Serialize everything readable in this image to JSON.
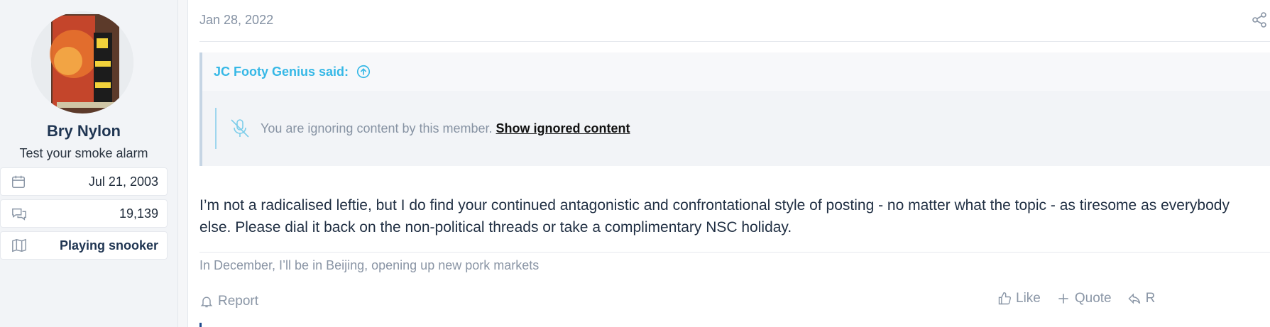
{
  "user": {
    "name": "Bry Nylon",
    "title": "Test your smoke alarm",
    "stats": [
      {
        "icon": "calendar-icon",
        "value": "Jul 21, 2003"
      },
      {
        "icon": "messages-icon",
        "value": "19,139"
      },
      {
        "icon": "map-icon",
        "value": "Playing snooker"
      }
    ]
  },
  "post": {
    "date": "Jan 28, 2022",
    "quote": {
      "author_line": "JC Footy Genius said:",
      "ignored_text": "You are ignoring content by this member.",
      "show_link": "Show ignored content"
    },
    "message": "I’m not a radicalised leftie, but I do find your continued antagonistic and confrontational style of posting - no matter what the topic - as tiresome as everybody else. Please dial it back on the non-political threads or take a complimentary NSC holiday.",
    "signature": "In December, I’ll be in Beijing, opening up new pork markets"
  },
  "actions": {
    "report": "Report",
    "like": "Like",
    "quote": "Quote",
    "reply_partial": "R"
  },
  "colors": {
    "accent": "#36b8e6",
    "name": "#1f3552",
    "muted": "#8a96a6"
  }
}
